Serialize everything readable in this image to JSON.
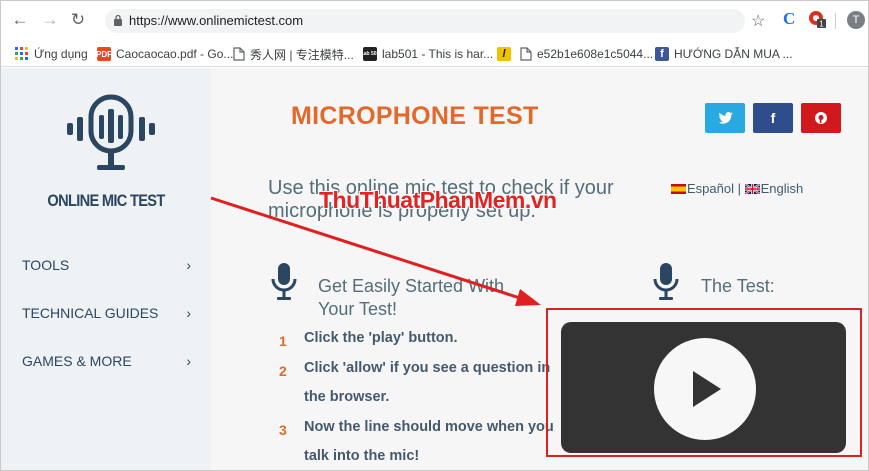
{
  "browser": {
    "url": "https://www.onlinemictest.com",
    "avatar_letter": "T",
    "ext_c_letter": "C",
    "ext_badge": "1",
    "bookmarks": [
      {
        "label": "Ứng dụng",
        "icon": "apps-grid-icon",
        "color": "#e8453c"
      },
      {
        "label": "Caocaocao.pdf - Go...",
        "icon": "pdf-icon",
        "icon_text": "PDF",
        "color": "#e64a19"
      },
      {
        "label": "秀人网 | 专注模特...",
        "icon": "page-icon",
        "color": "#5f6368"
      },
      {
        "label": "lab501 - This is har...",
        "icon": "lab501-icon",
        "icon_text": "Lab 501",
        "color": "#222222"
      },
      {
        "label": "",
        "icon": "l-logo-icon",
        "icon_text": "l",
        "color": "#f2c200"
      },
      {
        "label": "e52b1e608e1c5044...",
        "icon": "page-icon",
        "color": "#5f6368"
      },
      {
        "label": "HƯỚNG DẪN MUA ...",
        "icon": "facebook-icon",
        "icon_text": "f",
        "color": "#3b5998"
      }
    ]
  },
  "site": {
    "logo_text": "ONLINE MIC TEST",
    "menu": [
      "TOOLS",
      "TECHNICAL GUIDES",
      "GAMES & MORE"
    ],
    "title": "MICROPHONE TEST",
    "social": [
      {
        "name": "twitter",
        "glyph": "t",
        "color": "#29a9e1"
      },
      {
        "name": "facebook",
        "glyph": "f",
        "color": "#2f4d8b"
      },
      {
        "name": "pinterest",
        "glyph": "p",
        "color": "#d0181d"
      }
    ],
    "intro": "Use this online mic test to check if your microphone is properly set up.",
    "lang": {
      "es": "Español",
      "divider": "|",
      "en": "English"
    },
    "get_started_title": "Get Easily Started With Your Test!",
    "steps": [
      {
        "num": "1",
        "text": "Click the 'play' button."
      },
      {
        "num": "2",
        "text": "Click 'allow' if you see a question in the browser."
      },
      {
        "num": "3",
        "text": "Now the line should move when you talk into the mic!"
      }
    ],
    "test_title": "The Test:",
    "watermark": "ThuThuatPhanMem.vn"
  },
  "colors": {
    "accent": "#e4682a",
    "navy": "#2b4661",
    "highlight": "#e02020"
  }
}
